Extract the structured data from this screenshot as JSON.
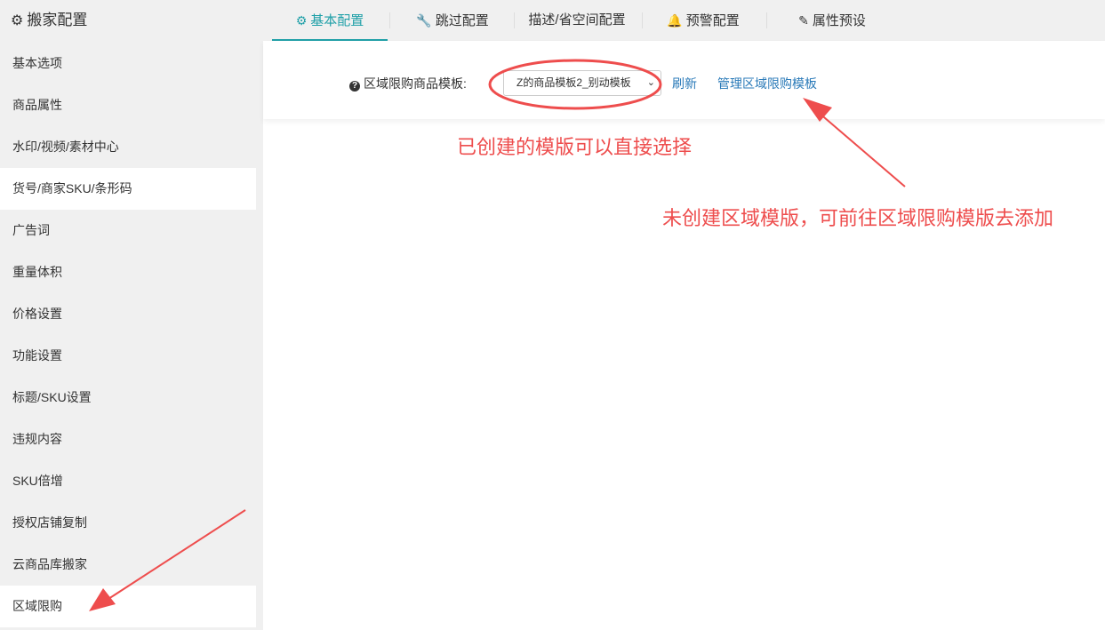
{
  "app": {
    "title": "搬家配置"
  },
  "tabs": [
    {
      "label": "基本配置",
      "icon": "settings-icon"
    },
    {
      "label": "跳过配置",
      "icon": "wrench-icon"
    },
    {
      "label": "描述/省空间配置",
      "icon": ""
    },
    {
      "label": "预警配置",
      "icon": "bell-icon"
    },
    {
      "label": "属性预设",
      "icon": "edit-icon"
    }
  ],
  "sidebar": {
    "items": [
      {
        "label": "基本选项"
      },
      {
        "label": "商品属性"
      },
      {
        "label": "水印/视频/素材中心"
      },
      {
        "label": "货号/商家SKU/条形码"
      },
      {
        "label": "广告词"
      },
      {
        "label": "重量体积"
      },
      {
        "label": "价格设置"
      },
      {
        "label": "功能设置"
      },
      {
        "label": "标题/SKU设置"
      },
      {
        "label": "违规内容"
      },
      {
        "label": "SKU倍增"
      },
      {
        "label": "授权店铺复制"
      },
      {
        "label": "云商品库搬家"
      },
      {
        "label": "区域限购"
      }
    ]
  },
  "form": {
    "label": "区域限购商品模板:",
    "select_value": "Z的商品模板2_别动模板",
    "refresh_link": "刷新",
    "manage_link": "管理区域限购模板"
  },
  "annotations": {
    "text1": "已创建的模版可以直接选择",
    "text2": "未创建区域模版，可前往区域限购模版去添加"
  },
  "colors": {
    "accent": "#20a0a8",
    "annotation": "#ee4d4d",
    "link": "#2a7ab8"
  }
}
